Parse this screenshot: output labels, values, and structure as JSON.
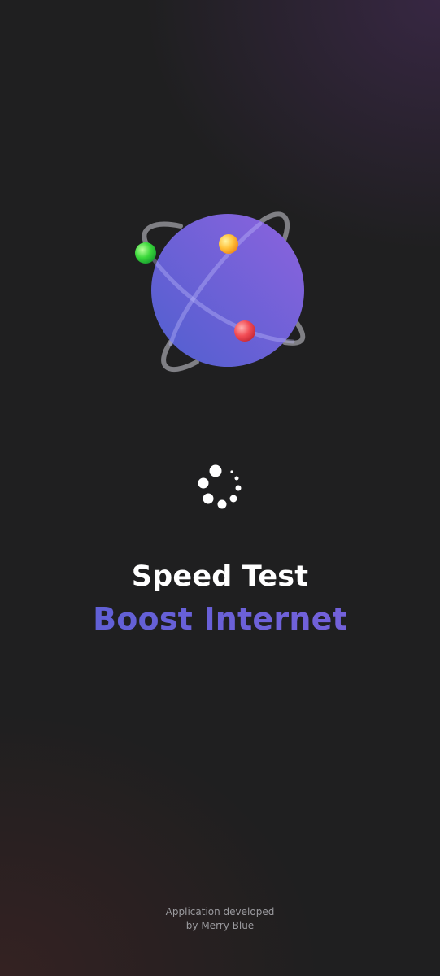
{
  "splash": {
    "title": "Speed Test",
    "subtitle": "Boost Internet",
    "credits_line1": "Application developed",
    "credits_line2": "by Merry Blue"
  },
  "logo": {
    "icon": "globe-with-orbits-icon",
    "planet_color_start": "#5b5fd2",
    "planet_color_end": "#8a63dd",
    "orbit_color": "#9a9a9e",
    "moon_colors": [
      "#3ad83a",
      "#ffb43a",
      "#f04a52"
    ]
  },
  "spinner": {
    "icon": "loading-spinner-icon",
    "color": "#ffffff"
  },
  "colors": {
    "background": "#1f1f20",
    "title": "#ffffff",
    "subtitle": "#6a5fd6",
    "credits": "#9a9a9e"
  }
}
